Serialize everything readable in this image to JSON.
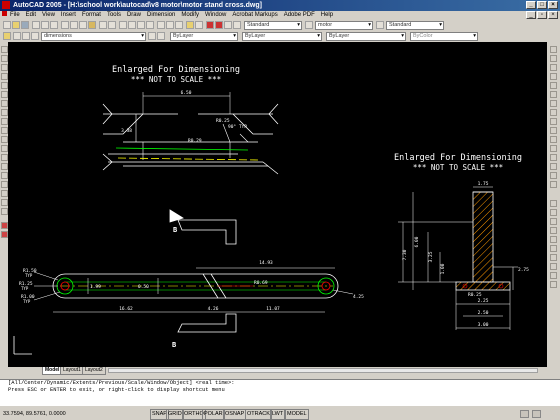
{
  "app": {
    "title": "AutoCAD 2005 - [H:\\school work\\autocad\\v8 motor\\motor stand cross.dwg]"
  },
  "menu": [
    "File",
    "Edit",
    "View",
    "Insert",
    "Format",
    "Tools",
    "Draw",
    "Dimension",
    "Modify",
    "Window",
    "Acrobat Markups",
    "Adobe PDF",
    "Help"
  ],
  "toolbar": {
    "text_style": "Standard",
    "dim_style": "motor",
    "table_style": "Standard",
    "layer": "dimensions",
    "color": "ByLayer",
    "linetype": "ByLayer",
    "lineweight": "ByLayer",
    "plotstyle": "ByColor"
  },
  "drawing": {
    "note1_line1": "Enlarged For Dimensioning",
    "note1_line2": "*** NOT TO SCALE ***",
    "note2_line1": "Enlarged For Dimensioning",
    "note2_line2": "*** NOT TO SCALE ***",
    "dims": {
      "d_650": "6.50",
      "d_338": "3.38",
      "d_r025": "R0.25",
      "d_90typ": "90° TYP",
      "d_r129": "R0.29",
      "d_1493": "14.93",
      "d_r150": "R1.50",
      "d_typ1": "TYP",
      "d_r125": "R1.25",
      "d_typ2": "TYP",
      "d_r100": "R1.00",
      "d_typ3": "TYP",
      "d_199": "1.99",
      "d_050": "0.50",
      "d_r069": "R0.69",
      "d_425": "4.25",
      "d_1662": "16.62",
      "d_426": "4.26",
      "d_1107": "11.07",
      "d_175": "1.75",
      "d_730": "7.30",
      "d_325": "3.25",
      "d_600": "6.00",
      "d_275": "2.75",
      "d_100": "1.00",
      "d_r025b": "R0.25",
      "d_225": "2.25",
      "d_250": "2.50",
      "d_300": "3.00"
    },
    "section_b1": "B",
    "section_b2": "B"
  },
  "tabs": [
    "Model",
    "Layout1",
    "Layout2"
  ],
  "command": {
    "line1": "[All/Center/Dynamic/Extents/Previous/Scale/Window/Object] <real time>:",
    "line2": "Press ESC or ENTER to exit, or right-click to display shortcut menu",
    "line3": ""
  },
  "status": {
    "coords": "33.7594, 89.5761, 0.0000",
    "toggles": [
      "SNAP",
      "GRID",
      "ORTHO",
      "POLAR",
      "OSNAP",
      "OTRACK",
      "LWT",
      "MODEL"
    ]
  }
}
